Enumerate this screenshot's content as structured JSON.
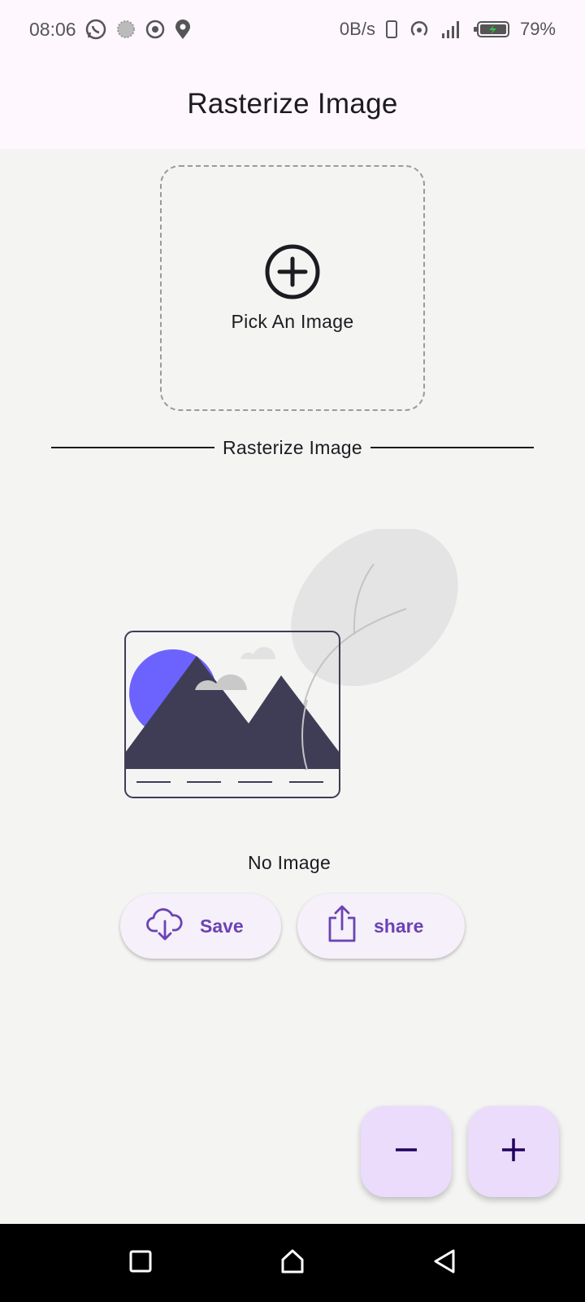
{
  "status_bar": {
    "time": "08:06",
    "net_speed": "0B/s",
    "battery_percent": "79%",
    "icons_left": [
      "whatsapp-icon",
      "spinner-icon",
      "record-icon",
      "location-icon"
    ],
    "icons_right": [
      "phone-frame-icon",
      "hotspot-icon",
      "signal-icon",
      "battery-charging-icon"
    ]
  },
  "app_bar": {
    "title": "Rasterize Image"
  },
  "picker": {
    "label": "Pick An Image",
    "icon": "add-circle-icon"
  },
  "divider": {
    "label": "Rasterize Image"
  },
  "preview": {
    "empty_label": "No Image",
    "illustration": "image-placeholder-illustration"
  },
  "actions": {
    "save_label": "Save",
    "save_icon": "cloud-download-icon",
    "share_label": "share",
    "share_icon": "share-icon"
  },
  "fabs": {
    "minus_icon": "minus-icon",
    "plus_icon": "plus-icon"
  },
  "nav": {
    "icons": [
      "recent-apps-icon",
      "home-icon",
      "back-icon"
    ]
  },
  "colors": {
    "accent": "#6a43b4",
    "fab_bg": "#eadcfa",
    "button_bg": "#f5f0f9",
    "app_bar_bg": "#fef7fe",
    "background": "#f4f4f3",
    "illustration_dark": "#3f3d56",
    "illustration_sun": "#6c63ff"
  }
}
